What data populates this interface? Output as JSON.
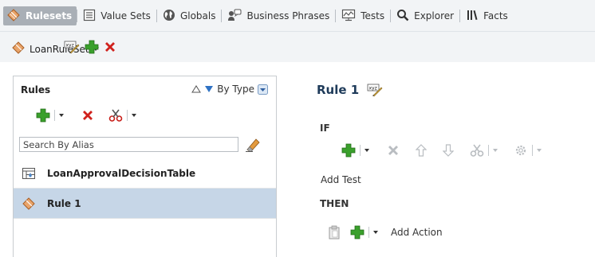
{
  "nav": {
    "tabs": [
      {
        "label": "Rulesets",
        "icon": "ruleset-icon"
      },
      {
        "label": "Value Sets",
        "icon": "value-sets-icon"
      },
      {
        "label": "Globals",
        "icon": "globe-icon"
      },
      {
        "label": "Business Phrases",
        "icon": "business-phrases-icon"
      },
      {
        "label": "Tests",
        "icon": "tests-icon"
      },
      {
        "label": "Explorer",
        "icon": "search-icon"
      },
      {
        "label": "Facts",
        "icon": "facts-icon"
      }
    ],
    "active": "Rulesets"
  },
  "ruleset_bar": {
    "selected_ruleset": "LoanRuleSet",
    "tools": [
      "edit-xyz-icon",
      "add-icon",
      "delete-icon"
    ]
  },
  "rules_panel": {
    "title": "Rules",
    "sort_label": "By Type",
    "search_placeholder": "Search By Alias",
    "items": [
      {
        "name": "LoanApprovalDecisionTable",
        "icon": "decision-table-icon",
        "selected": false
      },
      {
        "name": "Rule 1",
        "icon": "rule-diamond-icon",
        "selected": true
      }
    ]
  },
  "editor": {
    "title": "Rule 1",
    "if_label": "IF",
    "add_test_label": "Add Test",
    "then_label": "THEN",
    "add_action_label": "Add Action"
  },
  "colors": {
    "topbar_bg": "#f2f4f6",
    "active_tab_bg": "#a9afb6",
    "selected_row_bg": "#c6d6e7",
    "add_green": "#3aa02c",
    "delete_red": "#d0211c",
    "title_blue": "#1f3b5a"
  }
}
